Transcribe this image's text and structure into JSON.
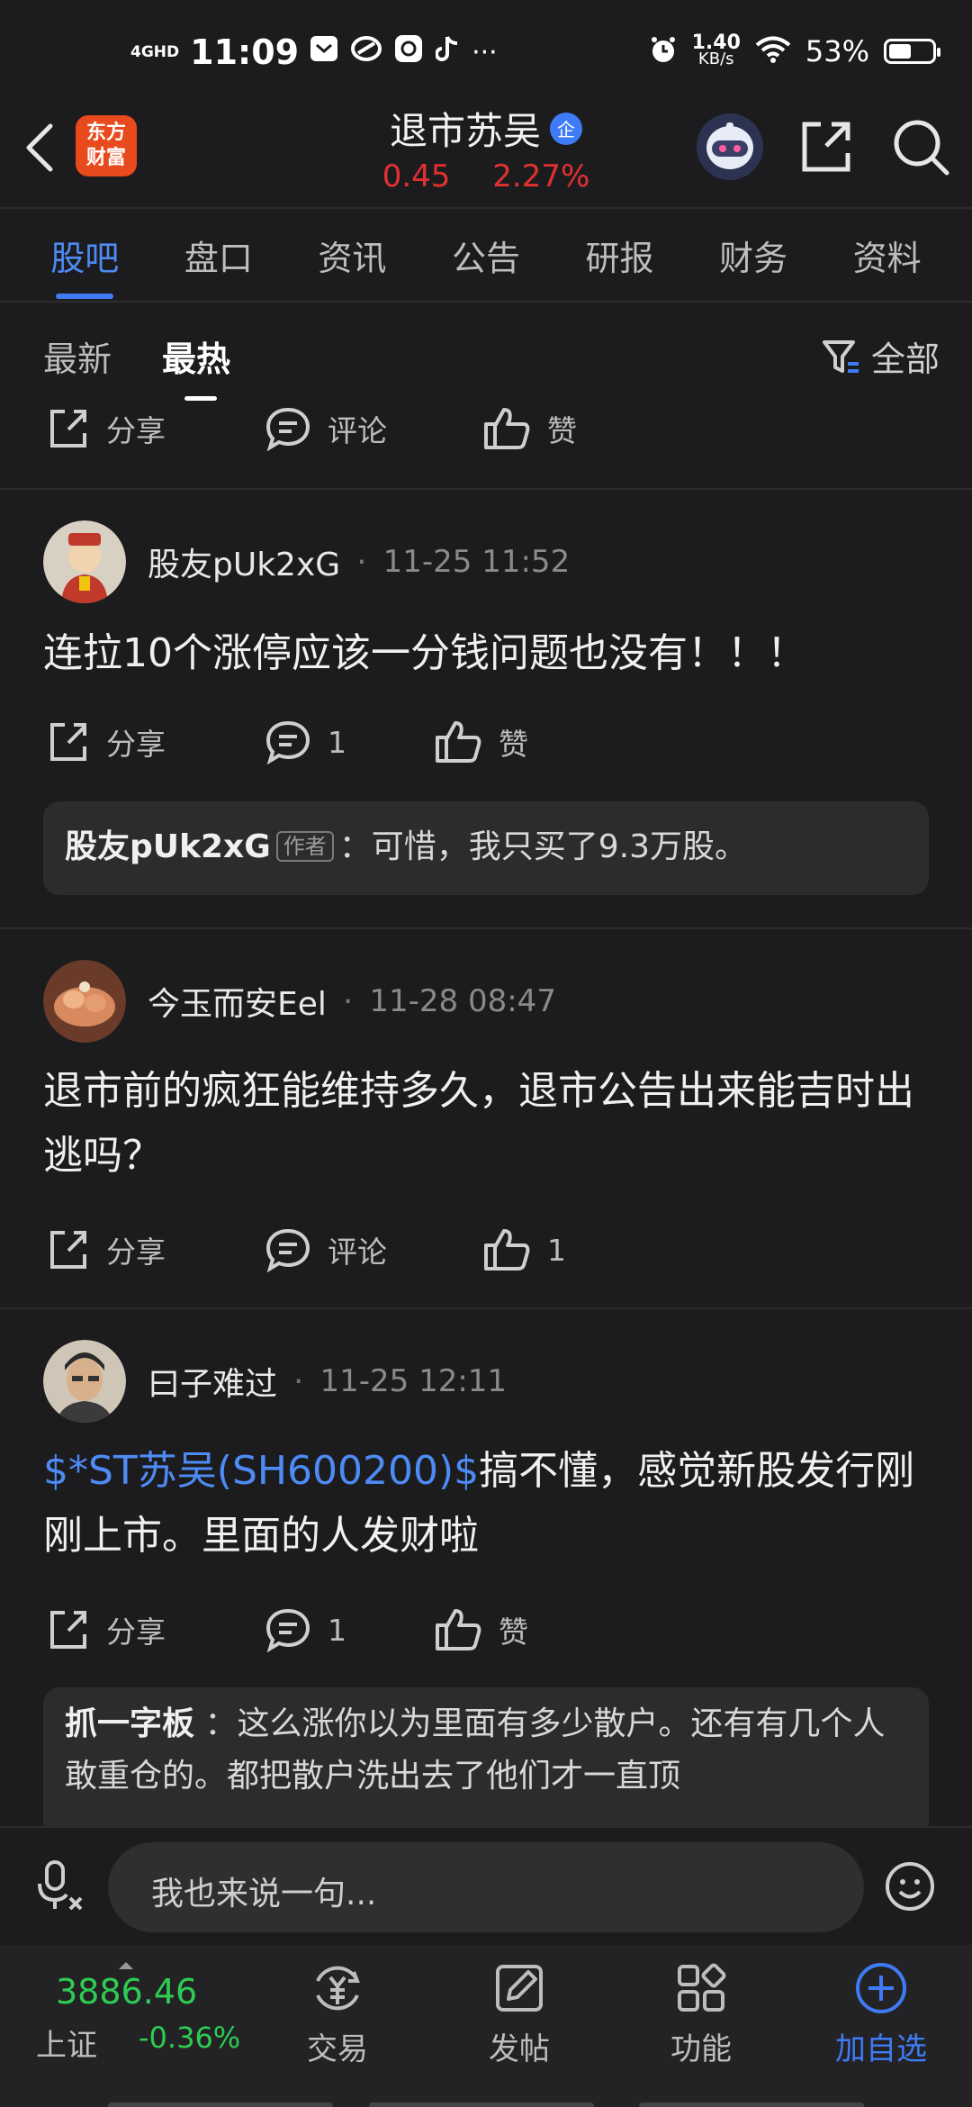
{
  "status_bar": {
    "network": "4GHD",
    "time": "11:09",
    "speed_value": "1.40",
    "speed_unit": "KB/s",
    "battery": "53%",
    "battery_fraction": 0.53
  },
  "header": {
    "logo_line1": "东方",
    "logo_line2": "财富",
    "title": "退市苏吴",
    "badge": "企",
    "price": "0.45",
    "change": "2.27%"
  },
  "tabs": [
    "股吧",
    "盘口",
    "资讯",
    "公告",
    "研报",
    "财务",
    "资料"
  ],
  "sort": {
    "latest": "最新",
    "hottest": "最热",
    "filter": "全部"
  },
  "action_labels": {
    "share": "分享",
    "comment": "评论",
    "like": "赞"
  },
  "posts": [
    {
      "author": "股友pUk2xG",
      "time": "11-25 11:52",
      "content": "连拉10个涨停应该一分钱问题也没有！！！",
      "comment_count": "1",
      "like_label": "赞",
      "reply": {
        "name": "股友pUk2xG",
        "tag": "作者",
        "text": "：可惜，我只买了9.3万股。"
      }
    },
    {
      "author": "今玉而安Eel",
      "time": "11-28 08:47",
      "content": "退市前的疯狂能维持多久，退市公告出来能吉时出逃吗？",
      "comment_label": "评论",
      "like_count": "1"
    },
    {
      "author": "曰子难过",
      "time": "11-25 12:11",
      "link": "$*ST苏吴(SH600200)$",
      "content": "搞不懂，感觉新股发行刚刚上市。里面的人发财啦",
      "comment_count": "1",
      "like_label": "赞",
      "reply": {
        "name": "抓一字板",
        "text": "：这么涨你以为里面有多少散户。还有有几个人敢重仓的。都把散户洗出去了他们才一直顶"
      }
    }
  ],
  "comment_bar": {
    "placeholder": "我也来说一句..."
  },
  "bottom_nav": {
    "index_value": "3886.46",
    "index_name": "上证",
    "index_change": "-0.36%",
    "trade": "交易",
    "post": "发帖",
    "functions": "功能",
    "add_watch": "加自选"
  }
}
